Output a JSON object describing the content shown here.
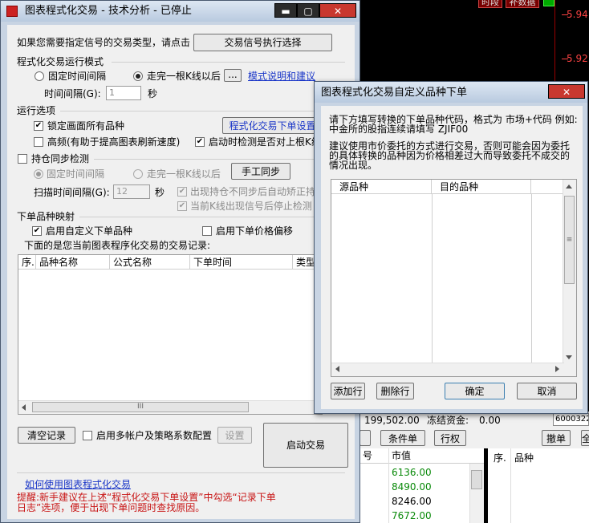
{
  "background": {
    "top_tabs": [
      "时段",
      "补数据"
    ],
    "prices": [
      "5.94",
      "5.92"
    ],
    "account": {
      "balance": "199,502.00",
      "frozen_label": "冻结资金:",
      "frozen_value": "0.00",
      "code_partial": "6000322"
    },
    "tabs": [
      "条件单",
      "行权"
    ],
    "right_buttons": [
      "撤单",
      "全"
    ],
    "col_no": "号",
    "col_value": "市值",
    "market_values": [
      "6136.00",
      "8490.00",
      "8246.00",
      "7672.00"
    ],
    "right_table_cols": [
      "序.",
      "品种"
    ]
  },
  "main_window": {
    "title": "图表程式化交易 - 技术分析 - 已停止",
    "controls": {
      "minimize": "▬",
      "maximize": "▢",
      "close": "✕"
    },
    "signal_prompt": "如果您需要指定信号的交易类型，请点击",
    "signal_button": "交易信号执行选择",
    "mode_section": "程式化交易运行模式",
    "mode_fixed": "固定时间间隔",
    "mode_kline": "走完一根K线以后",
    "mode_more": "...",
    "mode_link": "模式说明和建议",
    "interval_label": "时间间隔",
    "interval_value": "1",
    "interval_unit": "秒",
    "run_section": "运行选项",
    "opt_lock": "锁定画面所有品种",
    "opt_order_settings": "程式化交易下单设置",
    "opt_high_freq": "高频(有助于提高图表刷新速度)",
    "opt_check_on_start": "启动时检测是否对上根K线",
    "pos_sync": "持仓同步检测",
    "sync_fixed": "固定时间间隔",
    "sync_kline": "走完一根K线以后",
    "manual_sync": "手工同步",
    "scan_label": "扫描时间间隔",
    "scan_value": "12",
    "scan_unit": "秒",
    "sync_auto": "出现持仓不同步后自动矫正持",
    "sync_stop": "当前K线出现信号后停止检测",
    "map_section": "下单品种映射",
    "map_custom": "启用自定义下单品种",
    "map_offset": "启用下单价格偏移",
    "records_label": "下面的是您当前图表程序化交易的交易记录:",
    "records_cols": [
      "序.",
      "品种名称",
      "公式名称",
      "下单时间",
      "类型"
    ],
    "scroll_mark": "III",
    "clear_btn": "清空记录",
    "multi_account": "启用多帐户及策略系数配置",
    "settings_btn": "设置",
    "start_btn": "启动交易",
    "help_link": "如何使用图表程式化交易",
    "tip": "提醒:新手建议在上述“程式化交易下单设置”中勾选“记录下单日志”选项，便于出现下单问题时查找原因。"
  },
  "dialog": {
    "title": "图表程式化交易自定义品种下单",
    "close": "✕",
    "instructions": "请下方填写转换的下单品种代码，格式为 市场+代码 例如:中金所的股指连续请填写 ZJIF00",
    "advice": "建议使用市价委托的方式进行交易，否则可能会因为委托的具体转换的品种因为价格相差过大而导致委托不成交的情况出现。",
    "cols": [
      "源品种",
      "目的品种"
    ],
    "add_row": "添加行",
    "delete_row": "删除行",
    "ok": "确定",
    "cancel": "取消"
  }
}
